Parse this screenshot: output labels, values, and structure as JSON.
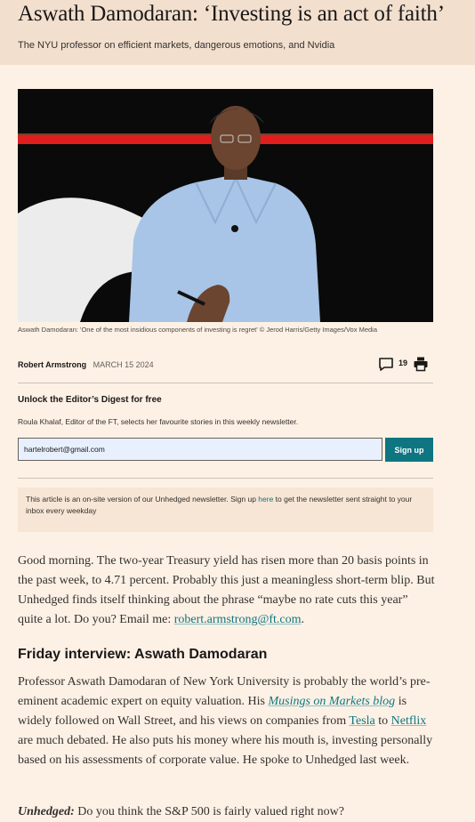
{
  "article": {
    "headline": "Aswath Damodaran: ‘Investing is an act of faith’",
    "standfirst": "The NYU professor on efficient markets, dangerous emotions, and Nvidia",
    "image_caption": "Aswath Damodaran: 'One of the most insidious components of investing is regret' © Jerod Harris/Getty Images/Vox Media",
    "author": "Robert Armstrong",
    "date": "MARCH 15 2024",
    "comment_count": "19"
  },
  "icons": {
    "comments": "speech-bubble-icon",
    "print": "printer-icon"
  },
  "newsletter": {
    "title": "Unlock the Editor’s Digest for free",
    "subtitle": "Roula Khalaf, Editor of the FT, selects her favourite stories in this weekly newsletter.",
    "email_value": "hartelrobert@gmail.com",
    "signup_label": "Sign up"
  },
  "notice": {
    "text_before": "This article is an on-site version of our Unhedged newsletter. Sign up ",
    "link": "here",
    "text_after": " to get the newsletter sent straight to your inbox every weekday"
  },
  "body": {
    "para1_text": "Good morning. The two-year Treasury yield has risen more than 20 basis points in the past week, to 4.71 percent. Probably this just a meaningless short-term blip. But Unhedged finds itself thinking about the phrase “maybe no rate cuts this year” quite a lot. Do you? Email me: ",
    "para1_email": "robert.armstrong@ft.com",
    "para1_end": ".",
    "section_heading": "Friday interview: Aswath Damodaran",
    "para2_a": "Professor Aswath Damodaran of New York University is probably the world’s pre-eminent academic expert on equity valuation. His ",
    "para2_blog": "Musings on Markets blog",
    "para2_b": " is widely followed on Wall Street, and his views on companies from ",
    "para2_tesla": "Tesla",
    "para2_c": " to ",
    "para2_netflix": "Netflix",
    "para2_d": " are much debated. He also puts his money where his mouth is, investing personally based on his assessments of corporate value. He spoke to Unhedged last week.",
    "q1_label": "Unhedged:",
    "q1_text": " Do you think the S&P 500 is fairly valued right now?"
  },
  "colors": {
    "page_background": "#fdf1e5",
    "header_background": "#f2dfce",
    "accent_teal": "#0d7680",
    "notice_background": "#f7e6d5",
    "stage_red_stripe": "#e01e1e"
  }
}
